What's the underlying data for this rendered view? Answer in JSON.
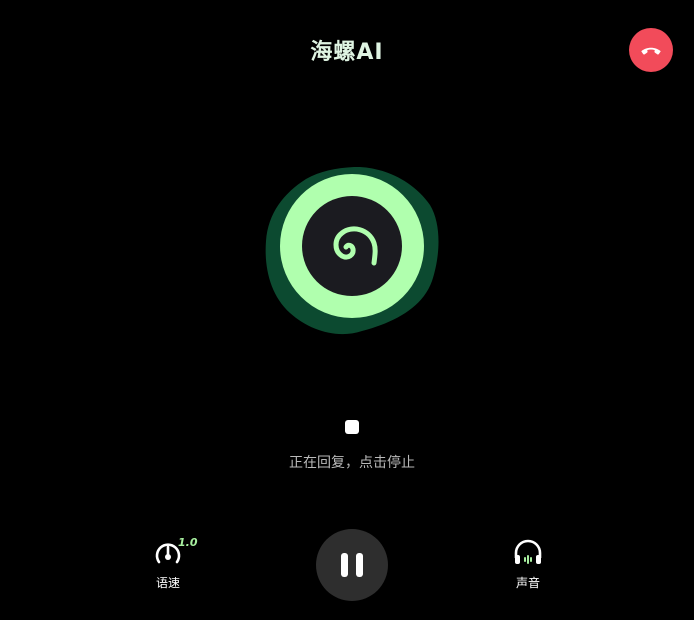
{
  "header": {
    "title": "海螺AI"
  },
  "call": {
    "hangup_icon": "phone-hangup-icon",
    "status_text": "正在回复，点击停止"
  },
  "controls": {
    "speed": {
      "label": "语速",
      "value": "1.0",
      "icon": "speedometer-icon"
    },
    "pause": {
      "icon": "pause-icon"
    },
    "voice": {
      "label": "声音",
      "icon": "headphones-icon"
    }
  },
  "colors": {
    "hangup": "#f24b5a",
    "ring_outer": "#0c4a30",
    "ring_light": "#b0ffae",
    "core": "#1b1b20",
    "accent": "#a8f0a0"
  }
}
